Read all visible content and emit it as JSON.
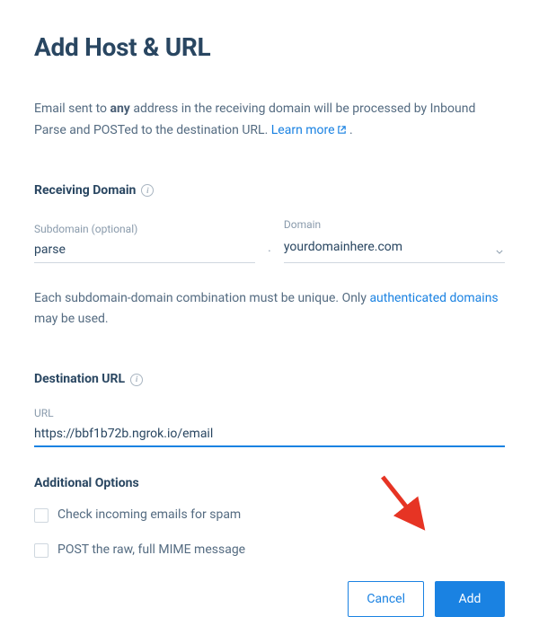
{
  "title": "Add Host & URL",
  "intro": {
    "prefix": "Email sent to ",
    "bold": "any",
    "suffix": " address in the receiving domain will be processed by Inbound Parse and POSTed to the destination URL. ",
    "learnMore": "Learn more",
    "period": " ."
  },
  "receivingDomain": {
    "label": "Receiving Domain",
    "subdomain": {
      "label": "Subdomain (optional)",
      "value": "parse"
    },
    "domain": {
      "label": "Domain",
      "value": "yourdomainhere.com"
    },
    "helperPrefix": "Each subdomain-domain combination must be unique. Only ",
    "helperLink": "authenticated domains",
    "helperSuffix": " may be used."
  },
  "destinationUrl": {
    "label": "Destination URL",
    "url": {
      "label": "URL",
      "value": "https://bbf1b72b.ngrok.io/email"
    }
  },
  "additionalOptions": {
    "label": "Additional Options",
    "spamCheck": {
      "label": "Check incoming emails for spam",
      "checked": false
    },
    "postRaw": {
      "label": "POST the raw, full MIME message",
      "checked": false
    }
  },
  "buttons": {
    "cancel": "Cancel",
    "add": "Add"
  }
}
